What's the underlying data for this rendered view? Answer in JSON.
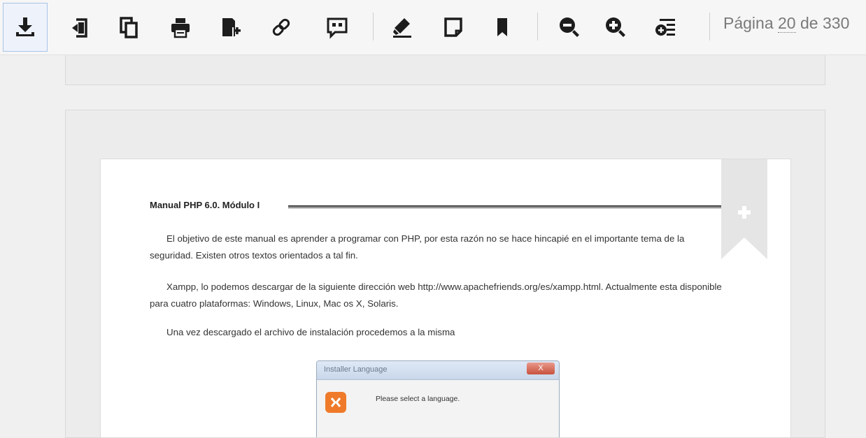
{
  "toolbar": {
    "buttons": [
      {
        "name": "download-button",
        "icon": "download-icon",
        "tooltip": "Descargar"
      },
      {
        "name": "rotate-button",
        "icon": "rotate-icon",
        "tooltip": "Girar"
      },
      {
        "name": "copy-button",
        "icon": "copy-icon",
        "tooltip": "Copiar"
      },
      {
        "name": "print-button",
        "icon": "print-icon",
        "tooltip": "Imprimir"
      },
      {
        "name": "add-to-list-button",
        "icon": "add-document-icon",
        "tooltip": "Añadir"
      },
      {
        "name": "link-button",
        "icon": "link-icon",
        "tooltip": "Enlace"
      },
      {
        "name": "quote-button",
        "icon": "quote-icon",
        "tooltip": "Citar"
      },
      {
        "name": "highlight-button",
        "icon": "highlighter-icon",
        "tooltip": "Resaltar"
      },
      {
        "name": "note-button",
        "icon": "sticky-note-icon",
        "tooltip": "Nota"
      },
      {
        "name": "bookmark-button",
        "icon": "bookmark-icon",
        "tooltip": "Marcador"
      },
      {
        "name": "zoom-out-button",
        "icon": "zoom-out-icon",
        "tooltip": "Alejar"
      },
      {
        "name": "zoom-in-button",
        "icon": "zoom-in-icon",
        "tooltip": "Acercar"
      },
      {
        "name": "contents-button",
        "icon": "table-of-contents-icon",
        "tooltip": "Contenido"
      }
    ],
    "page_indicator": {
      "prefix": "Página",
      "current": "20",
      "of": "de",
      "total": "330"
    }
  },
  "document": {
    "header": "Manual PHP 6.0. Módulo I",
    "paragraphs": [
      "El objetivo de este manual es aprender a programar con PHP, por esta razón no se hace hincapié en el importante tema de la seguridad. Existen otros textos orientados a tal fin.",
      "Xampp, lo podemos descargar de la siguiente dirección web http://www.apachefriends.org/es/xampp.html. Actualmente esta disponible para cuatro plataformas: Windows, Linux, Mac os X, Solaris.",
      "Una vez descargado el archivo de instalación procedemos a la misma"
    ],
    "figure": {
      "title": "Installer Language",
      "close_label": "X",
      "message": "Please select a language."
    }
  },
  "colors": {
    "accent": "#1d1d1d",
    "active_border": "#a9c2e8",
    "xampp_orange": "#ef7a2a"
  }
}
